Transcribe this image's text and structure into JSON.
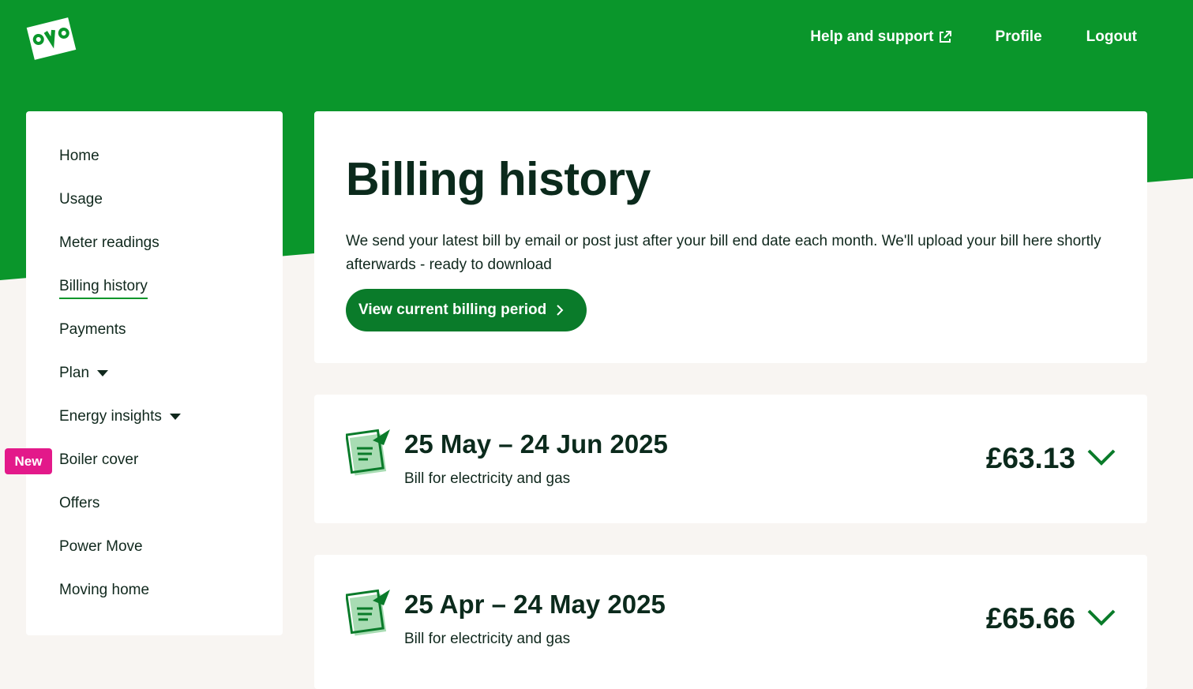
{
  "header": {
    "nav": [
      {
        "label": "Help and support",
        "external": true
      },
      {
        "label": "Profile"
      },
      {
        "label": "Logout"
      }
    ]
  },
  "sidebar": {
    "items": [
      {
        "label": "Home"
      },
      {
        "label": "Usage"
      },
      {
        "label": "Meter readings"
      },
      {
        "label": "Billing history",
        "active": true
      },
      {
        "label": "Payments"
      },
      {
        "label": "Plan",
        "dropdown": true
      },
      {
        "label": "Energy insights",
        "dropdown": true
      },
      {
        "label": "Boiler cover",
        "badge": "New"
      },
      {
        "label": "Offers"
      },
      {
        "label": "Power Move"
      },
      {
        "label": "Moving home"
      }
    ]
  },
  "main": {
    "title": "Billing history",
    "intro": "We send your latest bill by email or post just after your bill end date each month. We'll upload your bill here shortly afterwards - ready to download",
    "cta_label": "View current billing period",
    "bills": [
      {
        "period": "25 May – 24 Jun 2025",
        "description": "Bill for electricity and gas",
        "amount": "£63.13"
      },
      {
        "period": "25 Apr – 24 May 2025",
        "description": "Bill for electricity and gas",
        "amount": "£65.66"
      }
    ]
  },
  "colors": {
    "brand_green": "#0a962b",
    "button_green": "#0a7b2a",
    "badge_pink": "#e3198a",
    "text_dark": "#0b2a1c"
  }
}
